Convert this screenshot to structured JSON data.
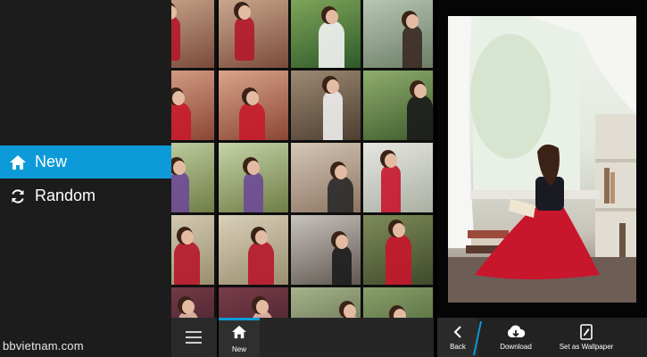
{
  "menu": {
    "items": [
      {
        "label": "New",
        "icon": "home-icon",
        "selected": true
      },
      {
        "label": "Random",
        "icon": "refresh-icon",
        "selected": false
      }
    ]
  },
  "watermark": "bbvietnam.com",
  "grid_tab": {
    "label": "New",
    "icon": "home-icon"
  },
  "viewer_actions": {
    "back": "Back",
    "download": "Download",
    "wallpaper": "Set as Wallpaper"
  },
  "colors": {
    "accent": "#0d9ad8",
    "menu_bg": "#1c1c1c",
    "bar_bg": "#262626"
  }
}
